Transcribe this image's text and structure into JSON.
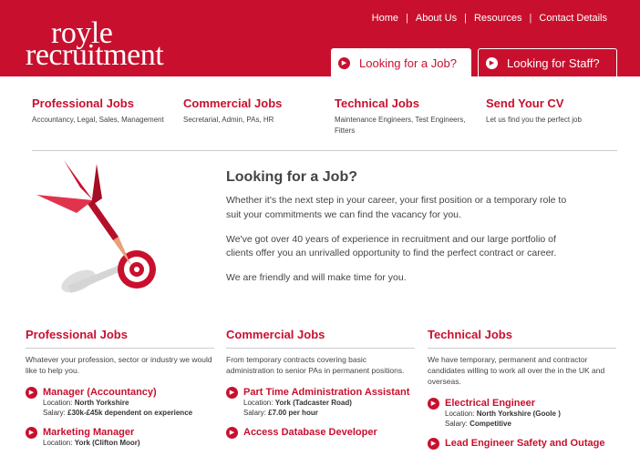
{
  "brand": {
    "line1": "royle",
    "line2": "recruitment"
  },
  "topnav": [
    "Home",
    "About Us",
    "Resources",
    "Contact Details"
  ],
  "tabs": {
    "job": "Looking for a Job?",
    "staff": "Looking for Staff?"
  },
  "categories": [
    {
      "title": "Professional Jobs",
      "desc": "Accountancy, Legal, Sales, Management"
    },
    {
      "title": "Commercial Jobs",
      "desc": "Secretarial, Admin, PAs, HR"
    },
    {
      "title": "Technical Jobs",
      "desc": "Maintenance Engineers, Test Engineers, Fitters"
    },
    {
      "title": "Send Your CV",
      "desc": "Let us find you the perfect job"
    }
  ],
  "intro": {
    "title": "Looking for a Job?",
    "p1": "Whether it's the next step in your career, your first position or a temporary role to suit your commitments we can find the vacancy for you.",
    "p2": "We've got over 40 years of experience in recruitment and our large portfolio of clients offer you an unrivalled opportunity to find the perfect contract or career.",
    "p3": "We are friendly and will make time for you."
  },
  "columns": [
    {
      "title": "Professional Jobs",
      "desc": "Whatever your profession, sector or industry we would like to help you.",
      "jobs": [
        {
          "title": "Manager (Accountancy)",
          "loc_label": "Location:",
          "loc": "North Yorkshire",
          "sal_label": "Salary:",
          "sal": "£30k-£45k dependent on experience"
        },
        {
          "title": "Marketing Manager",
          "loc_label": "Location:",
          "loc": "York (Clifton Moor)",
          "sal_label": "",
          "sal": ""
        }
      ]
    },
    {
      "title": "Commercial Jobs",
      "desc": "From temporary contracts covering basic administration to senior PAs in permanent positions.",
      "jobs": [
        {
          "title": "Part Time Administration Assistant",
          "loc_label": "Location:",
          "loc": "York (Tadcaster Road)",
          "sal_label": "Salary:",
          "sal": "£7.00 per hour"
        },
        {
          "title": "Access Database Developer",
          "loc_label": "",
          "loc": "",
          "sal_label": "",
          "sal": ""
        }
      ]
    },
    {
      "title": "Technical Jobs",
      "desc": "We have temporary, permanent and contractor candidates willing to work all over the in the UK and overseas.",
      "jobs": [
        {
          "title": "Electrical Engineer",
          "loc_label": "Location:",
          "loc": "North Yorkshire (Goole )",
          "sal_label": "Salary:",
          "sal": "Competitive"
        },
        {
          "title": "Lead Engineer Safety and Outage",
          "loc_label": "",
          "loc": "",
          "sal_label": "",
          "sal": ""
        }
      ]
    }
  ],
  "colors": {
    "brand_red": "#c8102e"
  },
  "icons": {
    "arrow": "arrow-right-circle-icon",
    "dart": "dart-target-icon"
  }
}
